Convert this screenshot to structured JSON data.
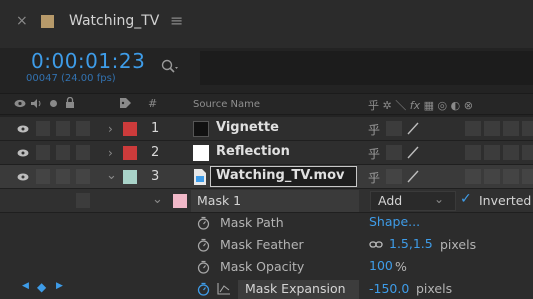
{
  "tab": {
    "title": "Watching_TV",
    "close_glyph": "×",
    "menu_glyph": "≡",
    "swatch_color": "#b79a6a"
  },
  "time": {
    "current": "0:00:01:23",
    "frames": "00047 (24.00 fps)"
  },
  "search": {
    "icon": "search-icon"
  },
  "columns": {
    "source_name": "Source Name",
    "label_glyph": "#"
  },
  "layers": [
    {
      "num": "1",
      "name": "Vignette",
      "label_color": "#cc3b3b",
      "thumb_color": "#111111",
      "switch_glyph": "乎"
    },
    {
      "num": "2",
      "name": "Reflection",
      "label_color": "#cc3b3b",
      "thumb_color": "#ffffff",
      "switch_glyph": "乎"
    },
    {
      "num": "3",
      "name": "Watching_TV.mov",
      "label_color": "#a9d3c9",
      "switch_glyph": "乎"
    }
  ],
  "mask": {
    "name": "Mask 1",
    "color": "#f0b8c8",
    "mode": "Add",
    "inverted_label": "Inverted",
    "properties": [
      {
        "name": "Mask Path",
        "value": "Shape...",
        "unit": ""
      },
      {
        "name": "Mask Feather",
        "value": "1.5,1.5",
        "unit": "pixels"
      },
      {
        "name": "Mask Opacity",
        "value": "100",
        "unit": "%"
      },
      {
        "name": "Mask Expansion",
        "value": "-150.0",
        "unit": "pixels"
      }
    ]
  },
  "colors": {
    "accent": "#3e9ce8"
  }
}
